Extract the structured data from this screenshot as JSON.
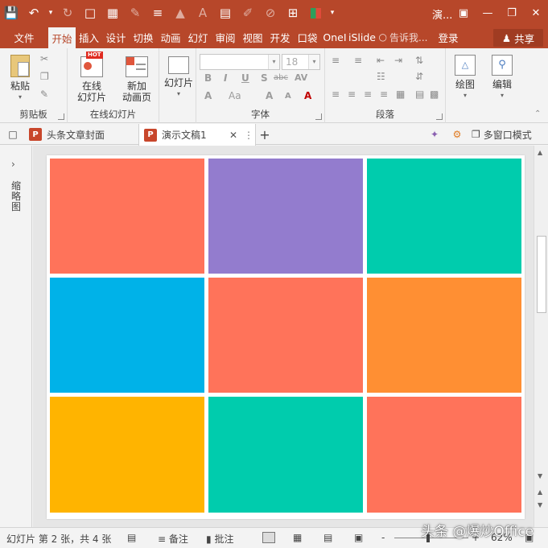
{
  "window": {
    "title": "演...",
    "accent_color": "#b7472a",
    "quick_access": [
      "save-icon",
      "undo-icon",
      "redo-icon",
      "new-file-icon",
      "layout-icon",
      "format-painter-icon",
      "align-icon",
      "fill-icon",
      "font-color-icon",
      "paste-icon",
      "brush-icon",
      "eraser-icon",
      "crop-icon",
      "color-icon"
    ],
    "window_buttons": [
      "ribbon-display-icon",
      "minimize-icon",
      "restore-icon",
      "close-icon"
    ]
  },
  "tabs": {
    "items": [
      {
        "label": "文件"
      },
      {
        "label": "开始"
      },
      {
        "label": "插入"
      },
      {
        "label": "设计"
      },
      {
        "label": "切换"
      },
      {
        "label": "动画"
      },
      {
        "label": "幻灯"
      },
      {
        "label": "审阅"
      },
      {
        "label": "视图"
      },
      {
        "label": "开发"
      },
      {
        "label": "口袋"
      },
      {
        "label": "OneI"
      },
      {
        "label": "iSlide"
      }
    ],
    "active": "开始",
    "tell_me": "告诉我...",
    "login": "登录",
    "share": "共享"
  },
  "ribbon": {
    "clipboard": {
      "paste": "粘贴",
      "group_label": "剪贴板"
    },
    "online_slides": {
      "online_slide": "在线\n幻灯片",
      "new_animation": "新加\n动画页",
      "hot_badge": "HOT",
      "group_label": "在线幻灯片"
    },
    "slides": {
      "slide_button": "幻灯片"
    },
    "font": {
      "font_name": "",
      "font_size": "18",
      "bold": "B",
      "italic": "I",
      "underline": "U",
      "shadow": "S",
      "strike": "abc",
      "spacing": "AV",
      "clear": "A",
      "case": "Aa",
      "grow": "A",
      "shrink": "A",
      "group_label": "字体"
    },
    "paragraph": {
      "group_label": "段落"
    },
    "drawing": {
      "label": "绘图"
    },
    "editing": {
      "label": "编辑"
    }
  },
  "doc_tabs": {
    "items": [
      {
        "label": "头条文章封面"
      },
      {
        "label": "演示文稿1"
      }
    ],
    "active": "演示文稿1",
    "add": "+",
    "multi_window": "多窗口模式"
  },
  "left_pane": {
    "label": "缩略图"
  },
  "slide": {
    "cells": [
      {
        "color": "#ff735a"
      },
      {
        "color": "#937cce"
      },
      {
        "color": "#00ccad"
      },
      {
        "color": "#00b2e8"
      },
      {
        "color": "#ff735a"
      },
      {
        "color": "#ff8f33"
      },
      {
        "color": "#ffb400"
      },
      {
        "color": "#00ccad"
      },
      {
        "color": "#ff735a"
      }
    ]
  },
  "status": {
    "slide_info": "幻灯片 第 2 张，共 4 张",
    "notes": "备注",
    "comments": "批注",
    "zoom_minus": "-",
    "zoom_plus": "+",
    "zoom": "62%"
  },
  "watermark": "头条 @爆炒Office"
}
